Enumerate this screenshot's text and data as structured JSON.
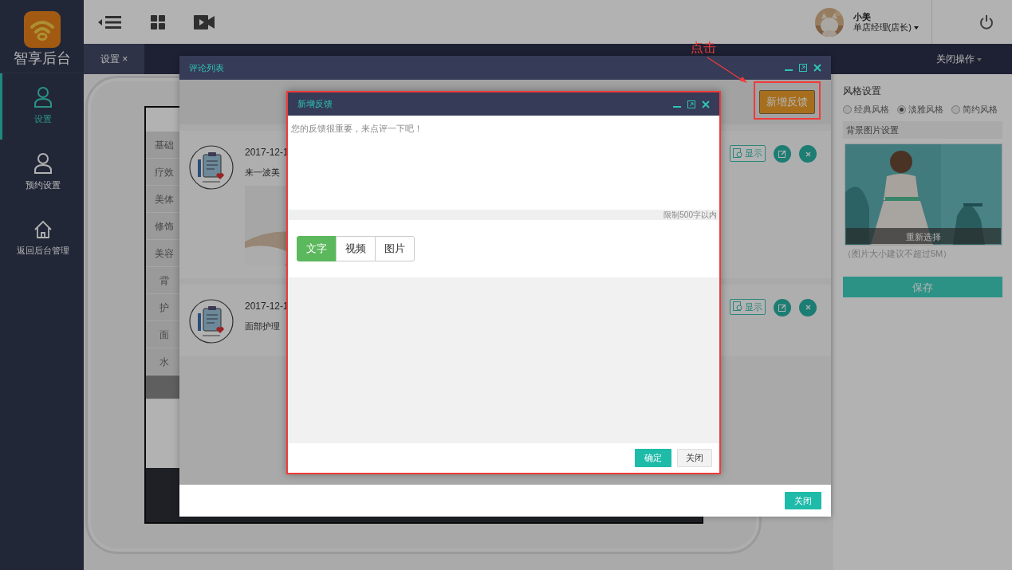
{
  "sidebar": {
    "logo_text": "智享后台",
    "items": [
      {
        "label": "设置",
        "kind": "person",
        "selected": true
      },
      {
        "label": "预约设置",
        "kind": "person",
        "selected": false
      },
      {
        "label": "返回后台管理",
        "kind": "home",
        "selected": false
      }
    ]
  },
  "topbar": {
    "user_name": "小美",
    "user_role": "单店经理(店长)"
  },
  "tabs": [
    {
      "label": "设置 ×",
      "selected": true
    }
  ],
  "tab_menu": "关闭操作",
  "preview_menu": [
    "基础",
    "疗效",
    "美体",
    "修饰",
    "美容",
    "背",
    "护",
    "面",
    "水"
  ],
  "settings_panel": {
    "style_title": "风格设置",
    "styles": [
      {
        "label": "经典风格",
        "selected": false
      },
      {
        "label": "淡雅风格",
        "selected": true
      },
      {
        "label": "简约风格",
        "selected": false
      }
    ],
    "background_title": "背景图片设置",
    "reselect": "重新选择",
    "hint": "（图片大小建议不超过5M）",
    "save": "保存"
  },
  "comment_dialog": {
    "title": "评论列表",
    "add_button": "新增反馈",
    "comments": [
      {
        "date": "2017-12-1",
        "text": "来一波美",
        "show_button": "显示"
      },
      {
        "date": "2017-12-1",
        "text": "面部护理",
        "kind": "text",
        "show_button": "显示"
      }
    ],
    "close": "关闭"
  },
  "feedback_dialog": {
    "title": "新增反馈",
    "placeholder": "您的反馈很重要，来点评一下吧！",
    "limit": "限制500字以内",
    "types": [
      {
        "label": "文字",
        "selected": true
      },
      {
        "label": "视频",
        "selected": false
      },
      {
        "label": "图片",
        "selected": false
      }
    ],
    "confirm": "确定",
    "close": "关闭"
  },
  "annotation": "点击"
}
